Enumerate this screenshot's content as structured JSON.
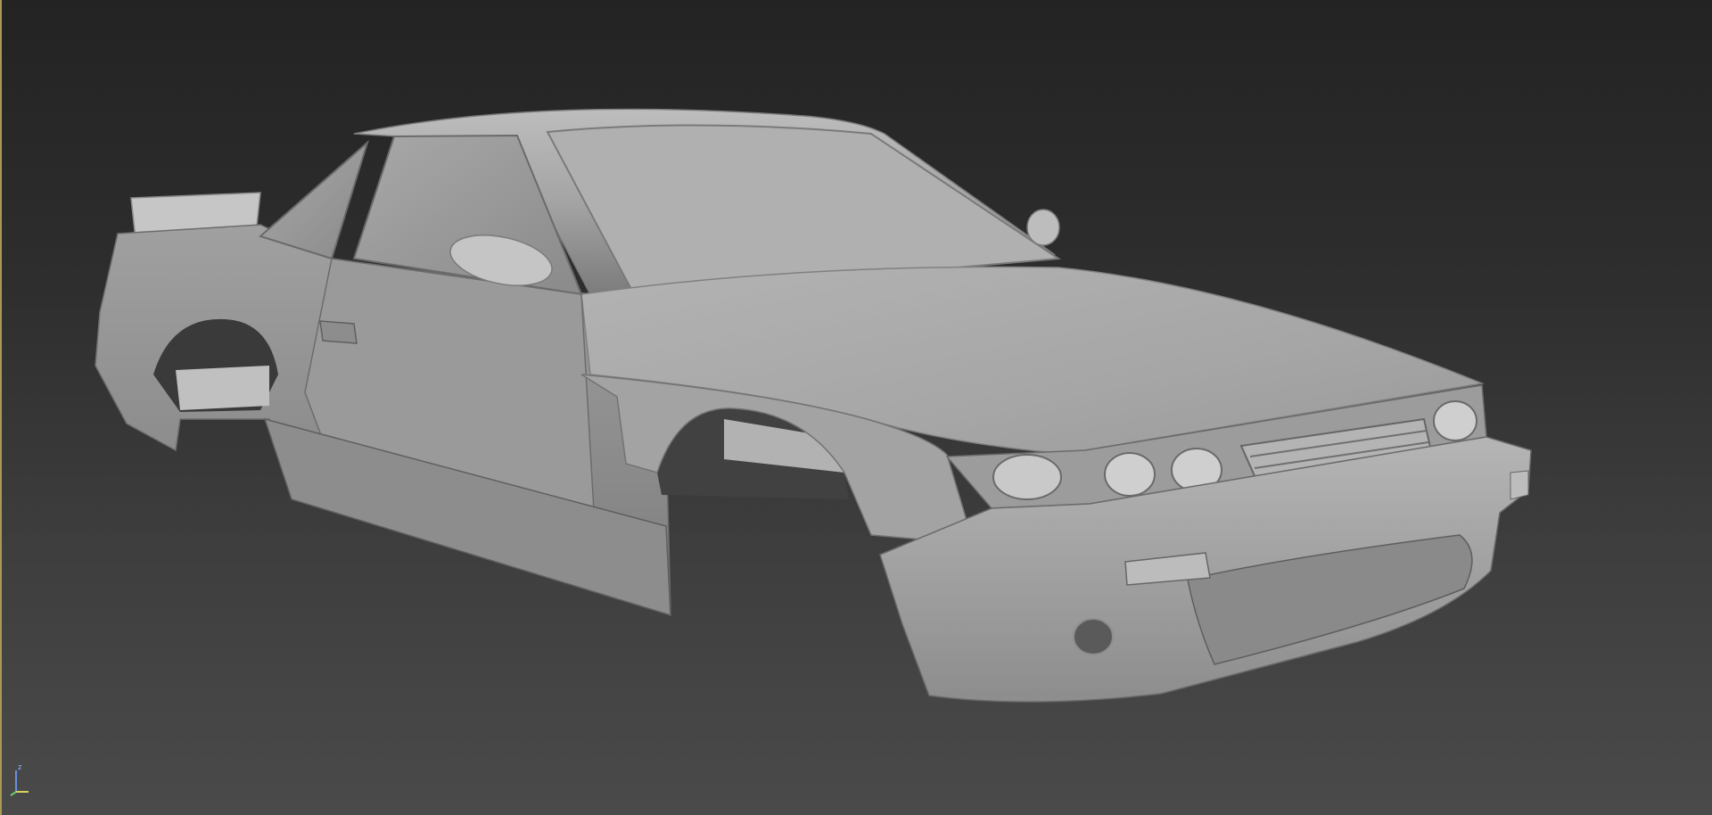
{
  "viewport": {
    "background_top": "#232323",
    "background_bottom": "#4a4a4a",
    "border_accent": "#a89a55",
    "model_color": "#a9a9a9",
    "model_shadow": "#6f6f6f",
    "model_highlight": "#c8c8c8"
  },
  "axis_gizmo": {
    "z_label": "z",
    "x_color": "#d6d25a",
    "y_color": "#6ad06a",
    "z_color": "#6a8fe0"
  }
}
